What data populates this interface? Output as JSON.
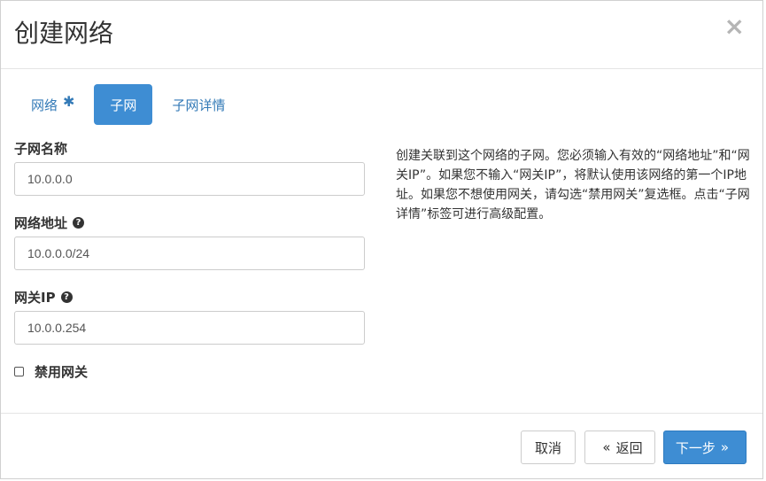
{
  "modal": {
    "title": "创建网络",
    "close_glyph": "×"
  },
  "tabs": [
    {
      "label": "网络",
      "required_mark": "✱"
    },
    {
      "label": "子网",
      "active": true
    },
    {
      "label": "子网详情"
    }
  ],
  "form": {
    "subnet_name": {
      "label": "子网名称",
      "value": "10.0.0.0"
    },
    "network_address": {
      "label": "网络地址",
      "value": "10.0.0.0/24",
      "help_glyph": "?"
    },
    "gateway_ip": {
      "label": "网关IP",
      "value": "10.0.0.254",
      "help_glyph": "?"
    },
    "disable_gateway": {
      "label": "禁用网关",
      "checked": false
    }
  },
  "help_text": "创建关联到这个网络的子网。您必须输入有效的“网络地址”和“网关IP”。如果您不输入“网关IP”，将默认使用该网络的第一个IP地址。如果您不想使用网关，请勾选“禁用网关”复选框。点击“子网详情”标签可进行高级配置。",
  "footer": {
    "cancel_label": "取消",
    "back_label": "返回",
    "back_chevron": "«",
    "next_label": "下一步",
    "next_chevron": "»"
  },
  "colors": {
    "primary": "#3e8dd3",
    "link": "#337ab7"
  }
}
